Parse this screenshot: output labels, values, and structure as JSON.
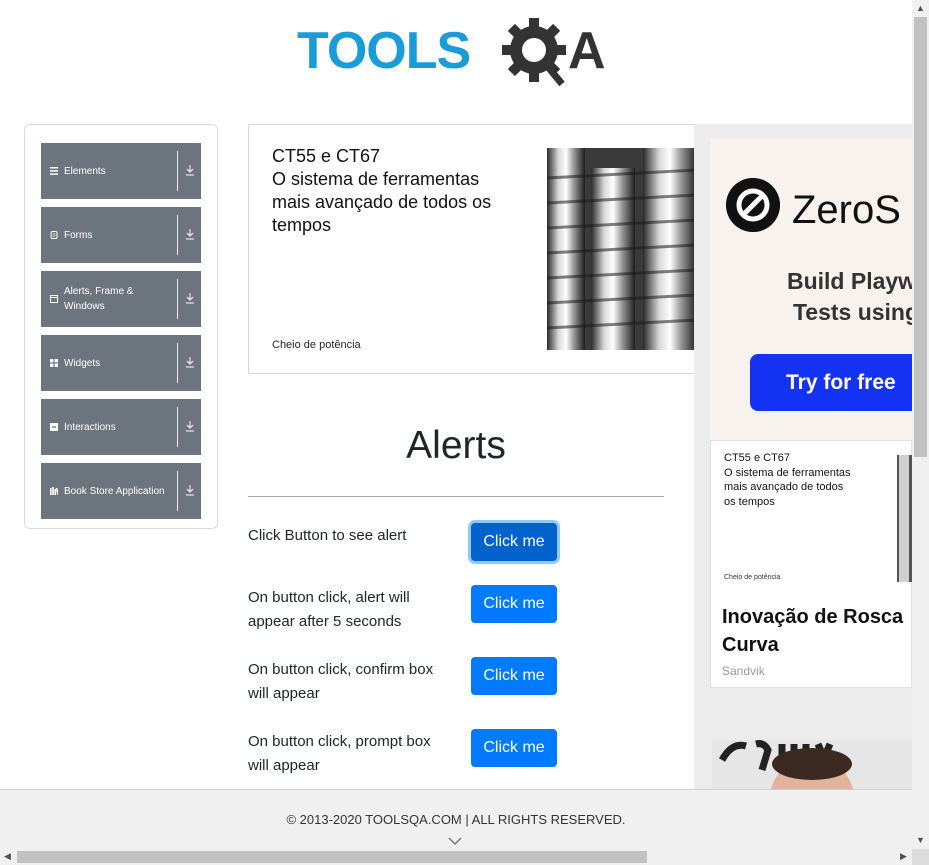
{
  "header": {
    "logo_text": "TOOLSQA"
  },
  "sidebar": {
    "items": [
      {
        "label": "Elements",
        "icon": "hamburger-icon"
      },
      {
        "label": "Forms",
        "icon": "form-icon"
      },
      {
        "label": "Alerts, Frame & Windows",
        "icon": "window-icon"
      },
      {
        "label": "Widgets",
        "icon": "grid-icon"
      },
      {
        "label": "Interactions",
        "icon": "interaction-icon"
      },
      {
        "label": "Book Store Application",
        "icon": "book-icon"
      }
    ]
  },
  "main_ad": {
    "headline": "CT55 e CT67\nO sistema de ferramentas mais avançado de todos os tempos",
    "tagline": "Cheio de potência"
  },
  "alerts": {
    "title": "Alerts",
    "rows": [
      {
        "label": "Click Button to see alert",
        "button": "Click me"
      },
      {
        "label": "On button click, alert will appear after 5 seconds",
        "button": "Click me"
      },
      {
        "label": "On button click, confirm box will appear",
        "button": "Click me"
      },
      {
        "label": "On button click, prompt box will appear",
        "button": "Click me"
      }
    ]
  },
  "right_ads": {
    "zerostep": {
      "brand": "ZeroS",
      "subtitle_line1": "Build Playwr",
      "subtitle_line2": "Tests using",
      "cta": "Try for free",
      "cta_color": "#1533f5"
    },
    "sandvik": {
      "headline": "CT55 e CT67\nO sistema de ferramentas mais avançado de todos os tempos",
      "tagline": "Cheio de potência",
      "title": "Inovação de Rosca Curva",
      "brand": "Sandvik"
    }
  },
  "footer": {
    "text": "© 2013-2020 TOOLSQA.COM | ALL RIGHTS RESERVED."
  },
  "colors": {
    "primary": "#007bff",
    "sidebar": "#6c757d",
    "logo_blue": "#1a9cd8",
    "logo_dark": "#333333"
  }
}
